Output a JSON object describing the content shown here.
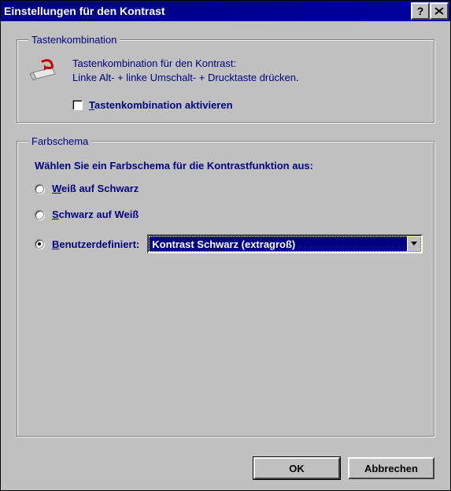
{
  "title": "Einstellungen für den Kontrast",
  "group1": {
    "legend": "Tastenkombination",
    "line1": "Tastenkombination für den Kontrast:",
    "line2": "Linke  Alt- + linke Umschalt- + Drucktaste drücken.",
    "checkbox_label_pre": "T",
    "checkbox_label_rest": "astenkombination aktivieren"
  },
  "group2": {
    "legend": "Farbschema",
    "prompt": "Wählen Sie ein Farbschema für die Kontrastfunktion aus:",
    "opt1_u": "W",
    "opt1_rest": "eiß auf Schwarz",
    "opt2_u": "S",
    "opt2_rest": "chwarz auf Weiß",
    "opt3_u": "B",
    "opt3_rest": "enutzerdefiniert:",
    "dropdown_value": "Kontrast Schwarz (extragroß)"
  },
  "buttons": {
    "ok": "OK",
    "cancel": "Abbrechen"
  }
}
